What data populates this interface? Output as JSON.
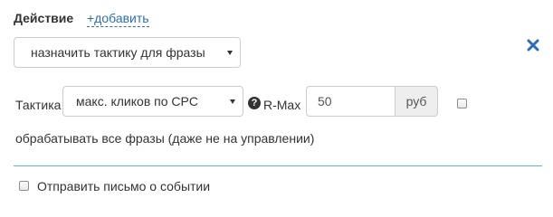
{
  "header": {
    "title": "Действие",
    "add_link": "+добавить"
  },
  "action": {
    "selected": "назначить тактику для фразы"
  },
  "tactic": {
    "label": "Тактика",
    "selected": "макс. кликов по CPC",
    "help_icon": "question-circle-icon",
    "rmax_label": "R-Max",
    "rmax_value": "50",
    "currency": "руб",
    "all_phrases_label": "обрабатывать все фразы (даже не на управлении)",
    "all_phrases_checked": false
  },
  "notify": {
    "label": "Отправить письмо о событии",
    "checked": false
  },
  "colors": {
    "accent": "#2a6ebb",
    "close": "#2a6ebb",
    "divider": "#5bb3d9"
  }
}
